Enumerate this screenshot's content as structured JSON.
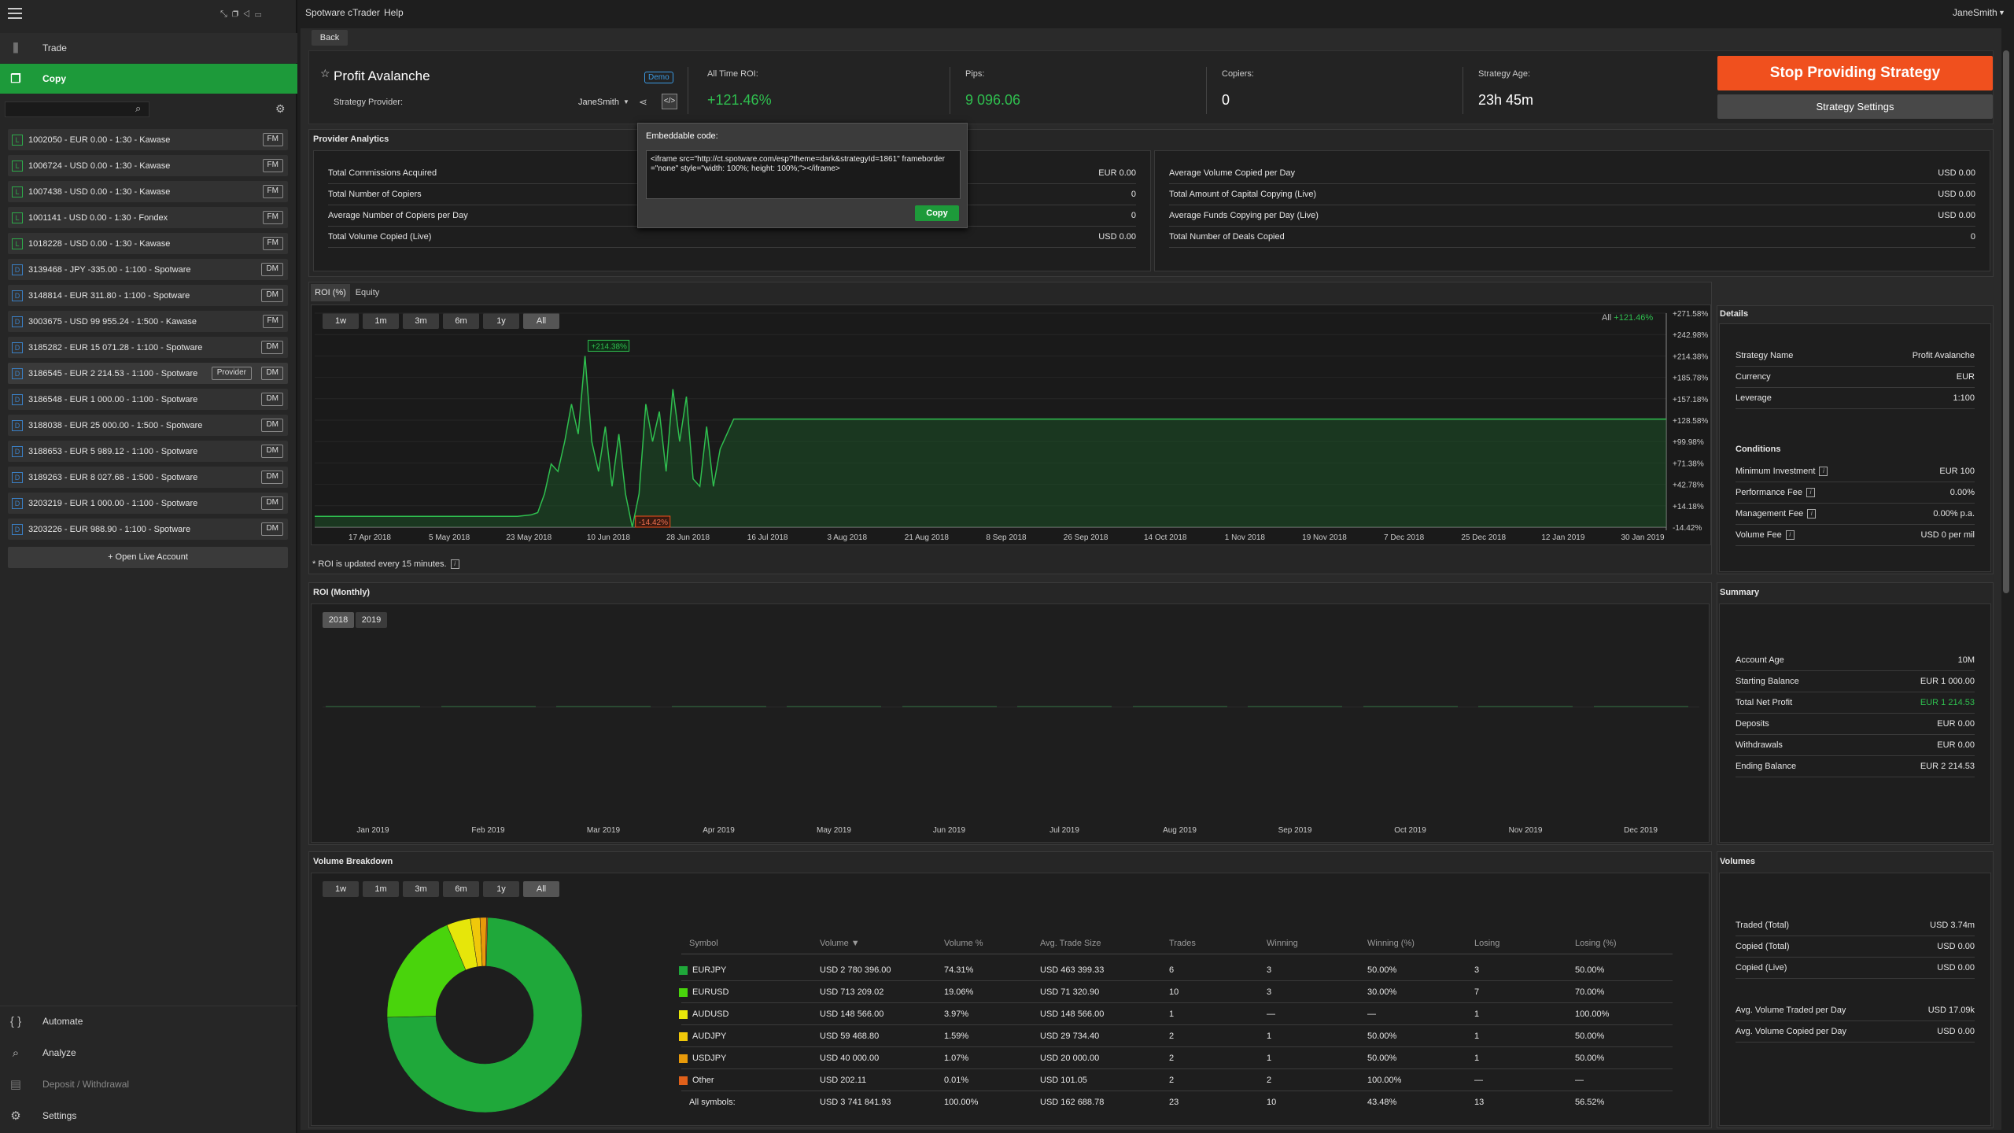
{
  "app": {
    "title": "Spotware cTrader",
    "help": "Help",
    "user": "JaneSmith"
  },
  "sidebar": {
    "nav": {
      "trade": "Trade",
      "copy": "Copy",
      "automate": "Automate",
      "analyze": "Analyze",
      "deposit": "Deposit / Withdrawal",
      "settings": "Settings"
    },
    "open_live": "+ Open Live Account",
    "accounts": [
      {
        "type": "L",
        "text": "1002050 - EUR 0.00 - 1:30 - Kawase",
        "tag": "FM"
      },
      {
        "type": "L",
        "text": "1006724 - USD 0.00 - 1:30 - Kawase",
        "tag": "FM"
      },
      {
        "type": "L",
        "text": "1007438 - USD 0.00 - 1:30 - Kawase",
        "tag": "FM"
      },
      {
        "type": "L",
        "text": "1001141 - USD 0.00 - 1:30 - Fondex",
        "tag": "FM"
      },
      {
        "type": "L",
        "text": "1018228 - USD 0.00 - 1:30 - Kawase",
        "tag": "FM"
      },
      {
        "type": "D",
        "text": "3139468 - JPY -335.00 - 1:100 - Spotware",
        "tag": "DM"
      },
      {
        "type": "D",
        "text": "3148814 - EUR 311.80 - 1:100 - Spotware",
        "tag": "DM"
      },
      {
        "type": "D",
        "text": "3003675 - USD 99 955.24 - 1:500 - Kawase",
        "tag": "FM"
      },
      {
        "type": "D",
        "text": "3185282 - EUR 15 071.28 - 1:100 - Spotware",
        "tag": "DM"
      },
      {
        "type": "D",
        "text": "3186545 - EUR 2 214.53 - 1:100 - Spotware",
        "tag": "DM",
        "extra": "Provider"
      },
      {
        "type": "D",
        "text": "3186548 - EUR 1 000.00 - 1:100 - Spotware",
        "tag": "DM"
      },
      {
        "type": "D",
        "text": "3188038 - EUR 25 000.00 - 1:500 - Spotware",
        "tag": "DM"
      },
      {
        "type": "D",
        "text": "3188653 - EUR 5 989.12 - 1:100 - Spotware",
        "tag": "DM"
      },
      {
        "type": "D",
        "text": "3189263 - EUR 8 027.68 - 1:500 - Spotware",
        "tag": "DM"
      },
      {
        "type": "D",
        "text": "3203219 - EUR 1 000.00 - 1:100 - Spotware",
        "tag": "DM"
      },
      {
        "type": "D",
        "text": "3203226 - EUR 988.90 - 1:100 - Spotware",
        "tag": "DM"
      }
    ]
  },
  "header": {
    "back": "Back",
    "name": "Profit Avalanche",
    "demo": "Demo",
    "provider_label": "Strategy Provider:",
    "provider": "JaneSmith",
    "stats": [
      {
        "label": "All Time ROI:",
        "value": "+121.46%",
        "green": true
      },
      {
        "label": "Pips:",
        "value": "9 096.06",
        "green": true
      },
      {
        "label": "Copiers:",
        "value": "0"
      },
      {
        "label": "Strategy Age:",
        "value": "23h 45m"
      }
    ],
    "stop": "Stop Providing Strategy",
    "settings": "Strategy Settings"
  },
  "embed": {
    "title": "Embeddable code:",
    "code": "<iframe src=\"http://ct.spotware.com/esp?theme=dark&strategyId=1861\" frameborder=\"none\" style=\"width: 100%; height: 100%;\"></iframe>",
    "copy": "Copy"
  },
  "analytics": {
    "title": "Provider Analytics",
    "left": [
      [
        "Total Commissions Acquired",
        "EUR 0.00"
      ],
      [
        "Total Number of Copiers",
        "0"
      ],
      [
        "Average Number of Copiers per Day",
        "0"
      ],
      [
        "Total Volume Copied (Live)",
        "USD 0.00"
      ]
    ],
    "right": [
      [
        "Average Volume Copied per Day",
        "USD 0.00"
      ],
      [
        "Total Amount of Capital Copying (Live)",
        "USD 0.00"
      ],
      [
        "Average Funds Copying per Day (Live)",
        "USD 0.00"
      ],
      [
        "Total Number of Deals Copied",
        "0"
      ]
    ]
  },
  "roi": {
    "tabs": [
      "ROI (%)",
      "Equity"
    ],
    "ranges": [
      "1w",
      "1m",
      "3m",
      "6m",
      "1y",
      "All"
    ],
    "legend_prefix": "All",
    "legend_value": "+121.46%",
    "note": "* ROI is updated every 15 minutes.",
    "max_label": "+214.38%",
    "min_label": "-14.42%"
  },
  "chart_data": {
    "type": "line",
    "title": "ROI (%)",
    "x": [
      "17 Apr 2018",
      "5 May 2018",
      "23 May 2018",
      "10 Jun 2018",
      "28 Jun 2018",
      "16 Jul 2018",
      "3 Aug 2018",
      "21 Aug 2018",
      "8 Sep 2018",
      "26 Sep 2018",
      "14 Oct 2018",
      "1 Nov 2018",
      "19 Nov 2018",
      "7 Dec 2018",
      "25 Dec 2018",
      "12 Jan 2019",
      "30 Jan 2019"
    ],
    "y_ticks": [
      "+271.58%",
      "+242.98%",
      "+214.38%",
      "+185.78%",
      "+157.18%",
      "+128.58%",
      "+99.98%",
      "+71.38%",
      "+42.78%",
      "+14.18%",
      "-14.42%"
    ],
    "ylim": [
      -14.42,
      271.58
    ],
    "series": [
      {
        "values": [
          [
            0,
            0
          ],
          [
            0.15,
            0
          ],
          [
            0.16,
            2
          ],
          [
            0.165,
            5
          ],
          [
            0.17,
            30
          ],
          [
            0.175,
            70
          ],
          [
            0.18,
            60
          ],
          [
            0.185,
            100
          ],
          [
            0.19,
            150
          ],
          [
            0.195,
            110
          ],
          [
            0.2,
            214.38
          ],
          [
            0.205,
            100
          ],
          [
            0.21,
            60
          ],
          [
            0.215,
            120
          ],
          [
            0.22,
            40
          ],
          [
            0.225,
            110
          ],
          [
            0.23,
            30
          ],
          [
            0.235,
            -14.42
          ],
          [
            0.24,
            30
          ],
          [
            0.245,
            150
          ],
          [
            0.25,
            100
          ],
          [
            0.255,
            140
          ],
          [
            0.26,
            60
          ],
          [
            0.265,
            170
          ],
          [
            0.27,
            100
          ],
          [
            0.275,
            160
          ],
          [
            0.28,
            50
          ],
          [
            0.285,
            40
          ],
          [
            0.29,
            120
          ],
          [
            0.295,
            40
          ],
          [
            0.3,
            90
          ],
          [
            0.31,
            130
          ],
          [
            0.33,
            130
          ],
          [
            1,
            130
          ]
        ]
      }
    ]
  },
  "monthly": {
    "title": "ROI (Monthly)",
    "years": [
      "2018",
      "2019"
    ],
    "months": [
      "Jan 2019",
      "Feb 2019",
      "Mar 2019",
      "Apr 2019",
      "May 2019",
      "Jun 2019",
      "Jul 2019",
      "Aug 2019",
      "Sep 2019",
      "Oct 2019",
      "Nov 2019",
      "Dec 2019"
    ]
  },
  "details": {
    "title": "Details",
    "rows": [
      [
        "Strategy Name",
        "Profit Avalanche"
      ],
      [
        "Currency",
        "EUR"
      ],
      [
        "Leverage",
        "1:100"
      ]
    ],
    "conditions": "Conditions",
    "cond": [
      [
        "Minimum Investment",
        "EUR 100"
      ],
      [
        "Performance Fee",
        "0.00%"
      ],
      [
        "Management Fee",
        "0.00% p.a."
      ],
      [
        "Volume Fee",
        "USD 0 per mil"
      ]
    ]
  },
  "summary": {
    "title": "Summary",
    "rows": [
      [
        "Account Age",
        "10M"
      ],
      [
        "Starting Balance",
        "EUR 1 000.00"
      ],
      [
        "Total Net Profit",
        "EUR 1 214.53"
      ],
      [
        "Deposits",
        "EUR 0.00"
      ],
      [
        "Withdrawals",
        "EUR 0.00"
      ],
      [
        "Ending Balance",
        "EUR 2 214.53"
      ]
    ]
  },
  "volumes": {
    "title": "Volumes",
    "rows": [
      [
        "Traded (Total)",
        "USD 3.74m"
      ],
      [
        "Copied (Total)",
        "USD 0.00"
      ],
      [
        "Copied (Live)",
        "USD 0.00"
      ],
      [
        "Avg. Volume Traded per Day",
        "USD 17.09k"
      ],
      [
        "Avg. Volume Copied per Day",
        "USD 0.00"
      ]
    ]
  },
  "breakdown": {
    "title": "Volume Breakdown",
    "ranges": [
      "1w",
      "1m",
      "3m",
      "6m",
      "1y",
      "All"
    ],
    "headers": [
      "Symbol",
      "Volume ▼",
      "Volume %",
      "Avg. Trade Size",
      "Trades",
      "Winning",
      "Winning (%)",
      "Losing",
      "Losing (%)"
    ],
    "rows": [
      {
        "color": "#1fa83a",
        "cells": [
          "EURJPY",
          "USD 2 780 396.00",
          "74.31%",
          "USD 463 399.33",
          "6",
          "3",
          "50.00%",
          "3",
          "50.00%"
        ]
      },
      {
        "color": "#49d40c",
        "cells": [
          "EURUSD",
          "USD 713 209.02",
          "19.06%",
          "USD 71 320.90",
          "10",
          "3",
          "30.00%",
          "7",
          "70.00%"
        ]
      },
      {
        "color": "#e6e60a",
        "cells": [
          "AUDUSD",
          "USD 148 566.00",
          "3.97%",
          "USD 148 566.00",
          "1",
          "—",
          "—",
          "1",
          "100.00%"
        ]
      },
      {
        "color": "#f0c80a",
        "cells": [
          "AUDJPY",
          "USD 59 468.80",
          "1.59%",
          "USD 29 734.40",
          "2",
          "1",
          "50.00%",
          "1",
          "50.00%"
        ]
      },
      {
        "color": "#e89a0a",
        "cells": [
          "USDJPY",
          "USD 40 000.00",
          "1.07%",
          "USD 20 000.00",
          "2",
          "1",
          "50.00%",
          "1",
          "50.00%"
        ]
      },
      {
        "color": "#e0601a",
        "cells": [
          "Other",
          "USD 202.11",
          "0.01%",
          "USD 101.05",
          "2",
          "2",
          "100.00%",
          "—",
          "—"
        ]
      }
    ],
    "total": [
      "All symbols:",
      "USD 3 741 841.93",
      "100.00%",
      "USD 162 688.78",
      "23",
      "10",
      "43.48%",
      "13",
      "56.52%"
    ]
  }
}
